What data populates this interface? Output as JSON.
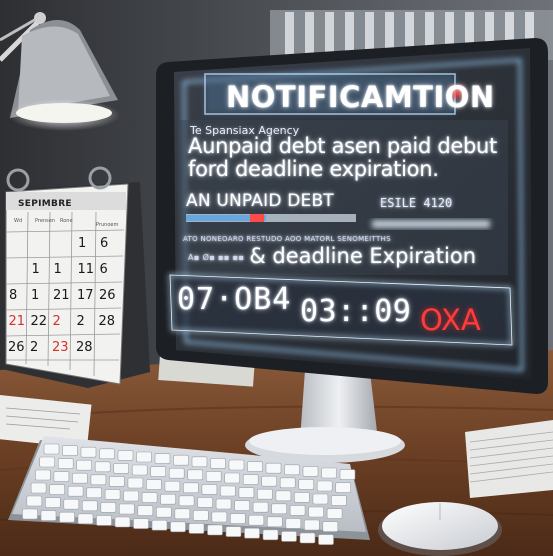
{
  "notification": {
    "title": "NOTIFICAMTION",
    "agency": "Te Spansiax Agency",
    "line1": "Aunpaid debt asen paid debut",
    "line2": "ford deadline expiration.",
    "unpaid_label": "AN UNPAID DEBT",
    "unpaid_right": "ESILE 4120",
    "small_row": "ATO NONEOARO RESTUDO AOO MATORL SENOMEITTHS",
    "deadline_prefix": "A▪ Ø▪ ▪▪ ▪▪",
    "deadline_text": "& deadline Expiration",
    "time_a": "07·OB4",
    "time_b": "03::09",
    "time_c": "OXA"
  },
  "calendar": {
    "month": "SEPIMBRE",
    "headers": [
      "Wd",
      "Prensen",
      "Rone",
      "Prunoem"
    ],
    "rows": [
      [
        "",
        "",
        "",
        "1",
        "6"
      ],
      [
        "",
        "1",
        "1",
        "11",
        "6"
      ],
      [
        "8",
        "1",
        "21",
        "17",
        "26"
      ],
      [
        "21",
        "22",
        "2",
        "2",
        "28"
      ],
      [
        "26",
        "2",
        "23",
        "28",
        ""
      ]
    ],
    "red_cells": [
      [
        3,
        0
      ],
      [
        3,
        2
      ],
      [
        4,
        2
      ]
    ]
  },
  "colors": {
    "screen_glow": "#9fd4ff",
    "alert_red": "#ff3b3b",
    "wood": "#6b3a22",
    "wall": "#3a3d42"
  },
  "icons": [
    "desk-lamp-icon",
    "monitor-icon",
    "keyboard-icon",
    "mouse-icon",
    "calendar-icon"
  ]
}
